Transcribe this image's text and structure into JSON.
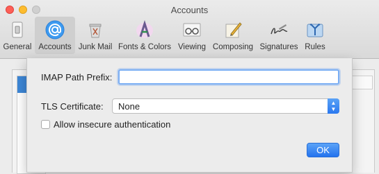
{
  "window": {
    "title": "Accounts"
  },
  "toolbar": {
    "items": [
      {
        "label": "General",
        "icon": "switch-icon",
        "selected": false
      },
      {
        "label": "Accounts",
        "icon": "at-sign-icon",
        "selected": true
      },
      {
        "label": "Junk Mail",
        "icon": "trash-bin-icon",
        "selected": false
      },
      {
        "label": "Fonts & Colors",
        "icon": "font-a-icon",
        "selected": false
      },
      {
        "label": "Viewing",
        "icon": "glasses-icon",
        "selected": false
      },
      {
        "label": "Composing",
        "icon": "pencil-paper-icon",
        "selected": false
      },
      {
        "label": "Signatures",
        "icon": "signature-icon",
        "selected": false
      },
      {
        "label": "Rules",
        "icon": "rules-icon",
        "selected": false
      }
    ]
  },
  "sheet": {
    "imap_label": "IMAP Path Prefix:",
    "imap_value": "",
    "tls_label": "TLS Certificate:",
    "tls_value": "None",
    "insecure_label": "Allow insecure authentication",
    "insecure_checked": false,
    "ok_label": "OK"
  },
  "colors": {
    "accent": "#2a78ef",
    "close": "#fd5f57",
    "minimize": "#fdbc2e"
  }
}
